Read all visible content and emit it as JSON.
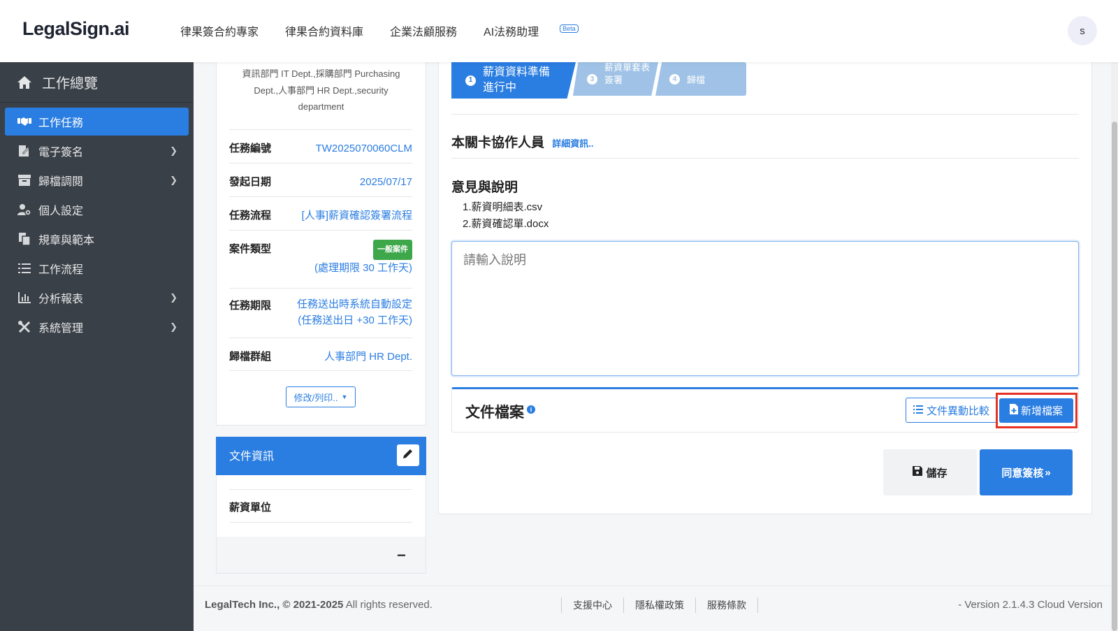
{
  "header": {
    "logo": "LegalSign.ai",
    "nav": [
      "律果簽合約專家",
      "律果合約資料庫",
      "企業法顧服務",
      "AI法務助理"
    ],
    "beta": "Beta",
    "avatar": "s"
  },
  "sidebar": {
    "title": "工作總覽",
    "items": [
      {
        "label": "工作任務",
        "icon": "handshake-icon"
      },
      {
        "label": "電子簽名",
        "icon": "signature-icon"
      },
      {
        "label": "歸檔調閱",
        "icon": "archive-icon"
      },
      {
        "label": "個人設定",
        "icon": "user-gear-icon"
      },
      {
        "label": "規章與範本",
        "icon": "copy-icon"
      },
      {
        "label": "工作流程",
        "icon": "list-check-icon"
      },
      {
        "label": "分析報表",
        "icon": "chart-icon"
      },
      {
        "label": "系統管理",
        "icon": "tools-icon"
      }
    ]
  },
  "task_info": {
    "departments": "資訊部門 IT Dept.,採購部門 Purchasing Dept.,人事部門 HR Dept.,security department",
    "task_no_label": "任務編號",
    "task_no": "TW2025070060CLM",
    "start_date_label": "發起日期",
    "start_date": "2025/07/17",
    "flow_label": "任務流程",
    "flow": "[人事]薪資確認簽署流程",
    "case_type_label": "案件類型",
    "case_type_tag": "一般案件",
    "case_deadline": "(處理期限 30 工作天)",
    "deadline_label": "任務期限",
    "deadline_line1": "任務送出時系統自動設定",
    "deadline_line2": "(任務送出日 +30 工作天)",
    "group_label": "歸檔群組",
    "group": "人事部門 HR Dept.",
    "modify_button": "修改/列印.."
  },
  "doc_info": {
    "title": "文件資訊",
    "salary_unit_label": "薪資單位"
  },
  "steps": [
    {
      "num": "1",
      "label_line1": "薪資資料準備",
      "label_line2": "進行中"
    },
    {
      "num": "3",
      "label_line1": "薪資單套表",
      "label_line2": "簽署"
    },
    {
      "num": "4",
      "label_line1": "歸檔",
      "label_line2": ""
    }
  ],
  "main": {
    "collab_title": "本關卡協作人員",
    "collab_link": "詳細資訊..",
    "opinion_title": "意見與說明",
    "files": [
      "1.薪資明細表.csv",
      "2.薪資確認單.docx"
    ],
    "textarea_placeholder": "請輸入說明",
    "doc_files_title": "文件檔案",
    "compare_button": "文件異動比較",
    "add_file_button": "新增檔案",
    "save_button": "儲存",
    "agree_button": "同意簽核"
  },
  "footer": {
    "company": "LegalTech Inc.,",
    "years": "© 2021-2025",
    "rights": "All rights reserved.",
    "links": [
      "支援中心",
      "隱私權政策",
      "服務條款"
    ],
    "version": "- Version 2.1.4.3 Cloud Version"
  },
  "colors": {
    "accent": "#2a7de1",
    "sidebar": "#3a4047",
    "tag": "#3da74a",
    "highlight": "#e53224"
  }
}
